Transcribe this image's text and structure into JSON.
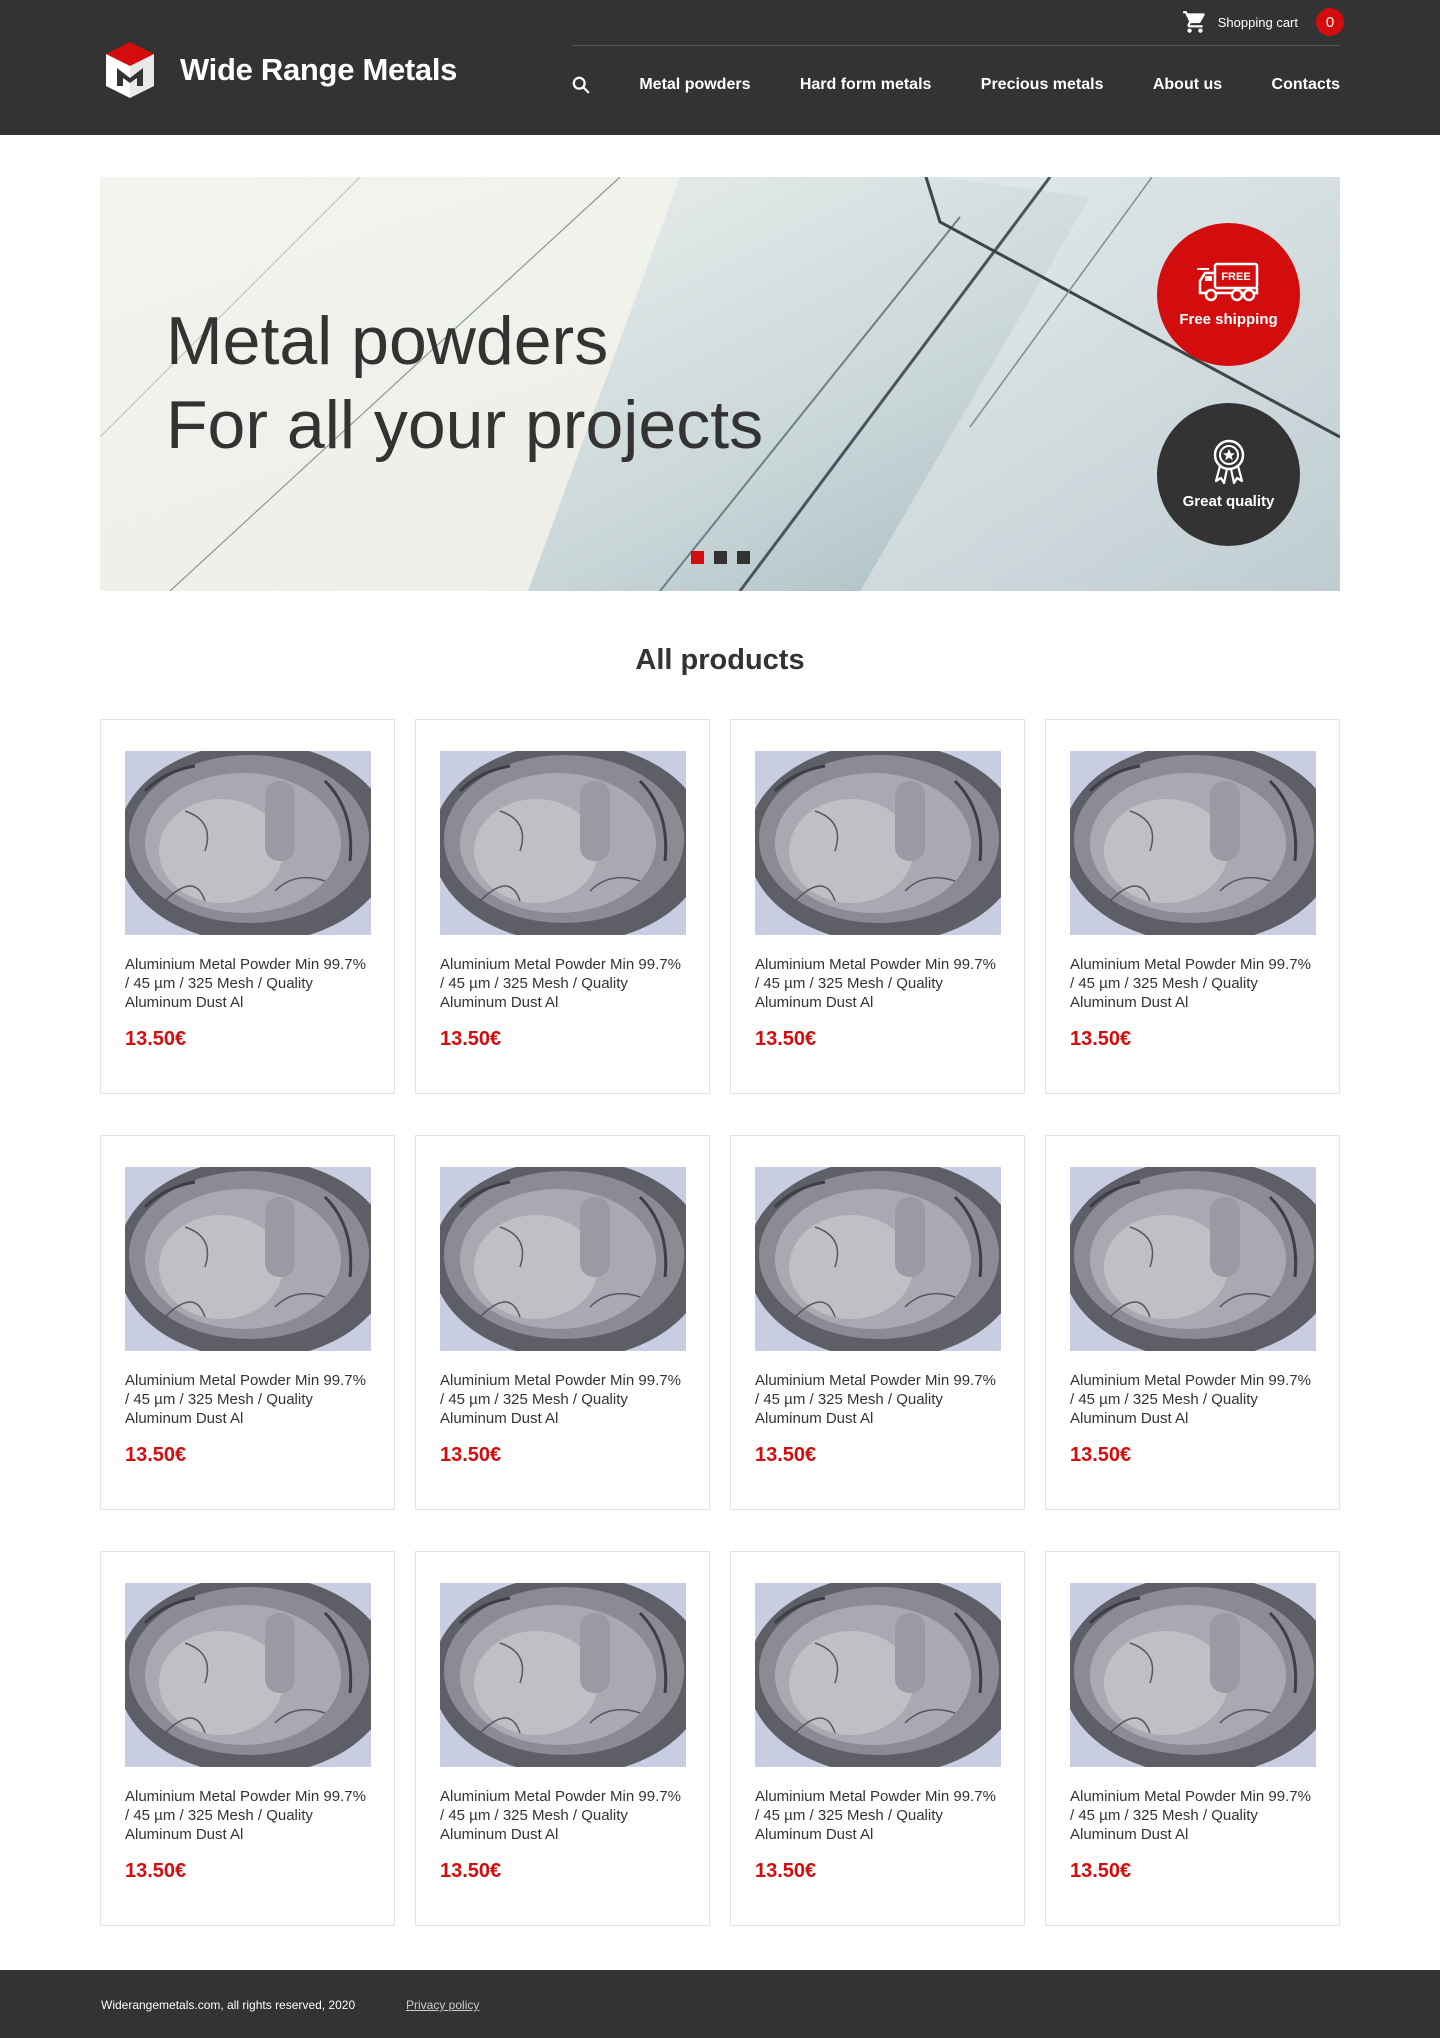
{
  "header": {
    "brand": "Wide Range Metals",
    "cart_label": "Shopping cart",
    "cart_count": "0",
    "nav": [
      "Metal powders",
      "Hard form metals",
      "Precious metals",
      "About us",
      "Contacts"
    ]
  },
  "hero": {
    "line1": "Metal powders",
    "line2": "For all your projects",
    "badge_shipping": "Free shipping",
    "badge_shipping_icon_text": "FREE",
    "badge_quality": "Great quality",
    "slides": 3,
    "active_slide": 1
  },
  "products": {
    "title": "All products",
    "items": [
      {
        "name": "Aluminium Metal Powder Min 99.7% / 45 µm / 325 Mesh / Quality Aluminum Dust Al",
        "price": "13.50€"
      },
      {
        "name": "Aluminium Metal Powder Min 99.7% / 45 µm / 325 Mesh / Quality Aluminum Dust Al",
        "price": "13.50€"
      },
      {
        "name": "Aluminium Metal Powder Min 99.7% / 45 µm / 325 Mesh / Quality Aluminum Dust Al",
        "price": "13.50€"
      },
      {
        "name": "Aluminium Metal Powder Min 99.7% / 45 µm / 325 Mesh / Quality Aluminum Dust Al",
        "price": "13.50€"
      },
      {
        "name": "Aluminium Metal Powder Min 99.7% / 45 µm / 325 Mesh / Quality Aluminum Dust Al",
        "price": "13.50€"
      },
      {
        "name": "Aluminium Metal Powder Min 99.7% / 45 µm / 325 Mesh / Quality Aluminum Dust Al",
        "price": "13.50€"
      },
      {
        "name": "Aluminium Metal Powder Min 99.7% / 45 µm / 325 Mesh / Quality Aluminum Dust Al",
        "price": "13.50€"
      },
      {
        "name": "Aluminium Metal Powder Min 99.7% / 45 µm / 325 Mesh / Quality Aluminum Dust Al",
        "price": "13.50€"
      },
      {
        "name": "Aluminium Metal Powder Min 99.7% / 45 µm / 325 Mesh / Quality Aluminum Dust Al",
        "price": "13.50€"
      },
      {
        "name": "Aluminium Metal Powder Min 99.7% / 45 µm / 325 Mesh / Quality Aluminum Dust Al",
        "price": "13.50€"
      },
      {
        "name": "Aluminium Metal Powder Min 99.7% / 45 µm / 325 Mesh / Quality Aluminum Dust Al",
        "price": "13.50€"
      },
      {
        "name": "Aluminium Metal Powder Min 99.7% / 45 µm / 325 Mesh / Quality Aluminum Dust Al",
        "price": "13.50€"
      }
    ]
  },
  "footer": {
    "copyright": "Widerangemetals.com, all rights reserved, 2020",
    "privacy": "Privacy policy"
  },
  "icons": {
    "logo": "cube-m-logo-icon",
    "cart": "shopping-cart-icon",
    "search": "search-icon",
    "shipping": "delivery-truck-icon",
    "quality": "award-ribbon-icon"
  },
  "colors": {
    "header": "#333333",
    "accent": "#d30d0d",
    "text": "#333333",
    "card_border": "#e2e2e2"
  }
}
